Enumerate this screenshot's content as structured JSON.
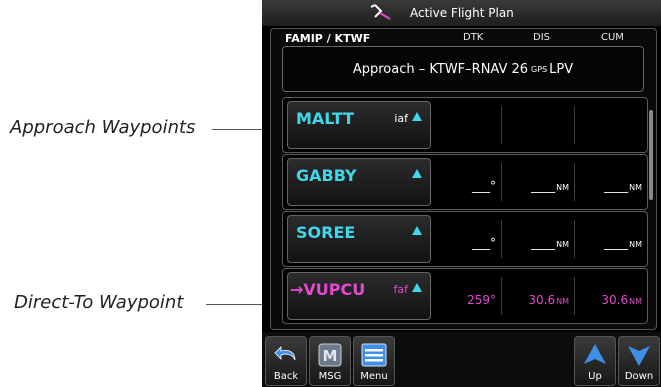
{
  "callouts": {
    "approach_waypoints": "Approach Waypoints",
    "direct_to_waypoint": "Direct-To Waypoint"
  },
  "window": {
    "title": "Active Flight Plan",
    "title_icon": "direct-to-plane-icon"
  },
  "header": {
    "route": "FAMIP / KTWF",
    "columns": [
      "DTK",
      "DIS",
      "CUM"
    ]
  },
  "approach": {
    "prefix": "Approach – KTWF–RNAV 26",
    "small": "GPS",
    "suffix": "LPV"
  },
  "waypoints": [
    {
      "name": "MALTT",
      "tag": "iaf",
      "dtk": "",
      "dis": "",
      "dis_unit": "",
      "cum": "",
      "cum_unit": "",
      "active": false
    },
    {
      "name": "GABBY",
      "tag": "",
      "dtk": "___°",
      "dis": "____",
      "dis_unit": "NM",
      "cum": "____",
      "cum_unit": "NM",
      "active": false
    },
    {
      "name": "SOREE",
      "tag": "",
      "dtk": "___°",
      "dis": "____",
      "dis_unit": "NM",
      "cum": "____",
      "cum_unit": "NM",
      "active": false
    },
    {
      "name": "VUPCU",
      "tag": "faf",
      "dtk": "259°",
      "dis": "30.6",
      "dis_unit": "NM",
      "cum": "30.6",
      "cum_unit": "NM",
      "active": true,
      "prefix": "→"
    }
  ],
  "softkeys": {
    "back": "Back",
    "msg": "MSG",
    "menu": "Menu",
    "up": "Up",
    "down": "Down"
  },
  "colors": {
    "waypoint": "#3fd7ec",
    "active": "#e24ad0",
    "background": "#000000"
  }
}
